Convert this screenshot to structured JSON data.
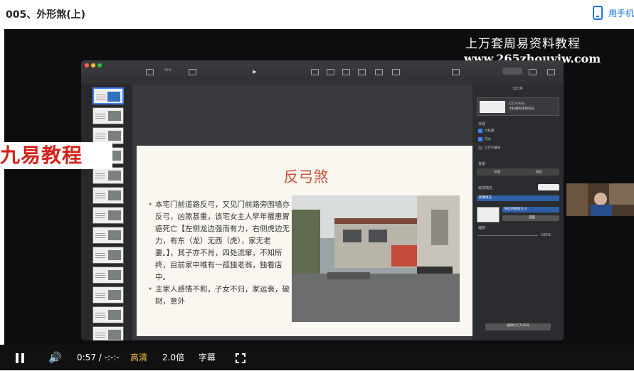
{
  "page": {
    "title": "005、外形煞(上)",
    "mobile_link": "用手机"
  },
  "watermark": {
    "line1": "上万套周易资料教程",
    "line2": "www.265zhouyiw.com"
  },
  "promo_banner": "九易教程",
  "keynote": {
    "doc_title": "",
    "toolbar": [
      {
        "label": "",
        "icon": "view-icon"
      },
      {
        "label": "52%",
        "icon": "zoom-icon"
      },
      {
        "label": "",
        "icon": "add-slide-icon"
      },
      {
        "label": "",
        "icon": "play-icon"
      },
      {
        "label": "",
        "icon": "table-icon"
      },
      {
        "label": "",
        "icon": "chart-icon"
      },
      {
        "label": "",
        "icon": "text-icon"
      },
      {
        "label": "",
        "icon": "shape-icon"
      },
      {
        "label": "",
        "icon": "media-icon"
      },
      {
        "label": "",
        "icon": "comment-icon"
      },
      {
        "label": "",
        "icon": "collaborate-icon"
      },
      {
        "label": "",
        "icon": "format-icon"
      },
      {
        "label": "",
        "icon": "animate-icon"
      },
      {
        "label": "",
        "icon": "document-icon"
      }
    ],
    "slide": {
      "title": "反弓煞",
      "bullets": [
        "本宅门前道路反弓，又见门前路旁围墙亦反弓，凶煞甚重，该宅女主人早年罹患胃癌死亡【左侧龙边强而有力，右侧虎边无力，有东（龙）无西（虎），家无老妻。】，其子亦不肖，四处流窜，不知所终，目前家中唯有一孤独老翁，独看店中。",
        "主家人感情不和，子女不归，家运衰，破财，意外"
      ]
    },
    "inspector": {
      "header": "幻灯片",
      "layout_line1": "幻灯片布局",
      "layout_line2": "大标题和项目符号",
      "appearance_label": "外观",
      "checks": [
        {
          "label": "大标题",
          "checked": true
        },
        {
          "label": "内文",
          "checked": true
        },
        {
          "label": "幻灯片编号",
          "checked": false
        }
      ],
      "background_label": "背景",
      "bg_tabs": [
        "标准",
        "动态"
      ],
      "fill_label": "目前填充",
      "fill_value": "影像填充",
      "scale_value": "按比例缩放大小",
      "choose_button": "选取",
      "opacity_label": "缩放",
      "opacity_value": "100%",
      "edit_button": "编辑幻灯片布局"
    },
    "thumb_count": 13
  },
  "webcam": {
    "label": ""
  },
  "controls": {
    "time": "0:57",
    "separator": "/",
    "duration": "-:-:-",
    "quality": "高清",
    "speed": "2.0倍",
    "subtitle": "字幕"
  },
  "colors": {
    "quality": "#f5c04a",
    "slide_title": "#c7563a",
    "promo_text": "#d3231b",
    "mobile_link": "#1a73e8"
  }
}
